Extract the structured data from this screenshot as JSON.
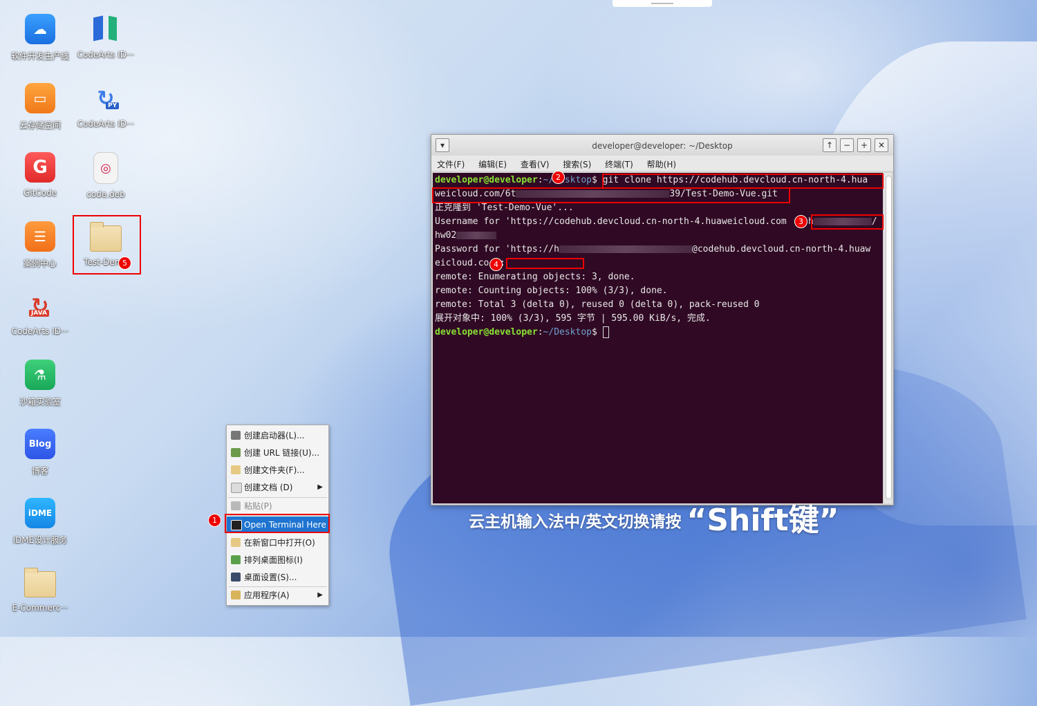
{
  "desktop": {
    "icons": [
      {
        "label": "软件开发生产线",
        "icon": "devcloud-icon"
      },
      {
        "label": "CodeArts ID···",
        "icon": "codearts-ide-icon"
      },
      {
        "label": "云存储空间",
        "icon": "cloud-storage-icon"
      },
      {
        "label": "CodeArts ID···",
        "icon": "codearts-python-icon",
        "badge": "PY"
      },
      {
        "label": "GitCode",
        "icon": "gitcode-icon",
        "glyph": "G"
      },
      {
        "label": "code.deb",
        "icon": "deb-package-icon"
      },
      {
        "label": "案例中心",
        "icon": "case-center-icon"
      },
      {
        "label": "Test-Demo",
        "icon": "folder-icon"
      },
      {
        "label": "CodeArts ID···",
        "icon": "codearts-java-icon",
        "badge": "JAVA"
      },
      {
        "label": "沙箱实验室",
        "icon": "sandbox-lab-icon"
      },
      {
        "label": "博客",
        "icon": "blog-icon",
        "glyph": "Blog"
      },
      {
        "label": "iDME设计服务",
        "icon": "idme-icon",
        "glyph": "iDME"
      },
      {
        "label": "E-Commerc···",
        "icon": "folder-icon"
      }
    ],
    "ime_hint": "云主机输入法中/英文切换请按",
    "ime_key": "“Shift键”"
  },
  "annotations": [
    "1",
    "2",
    "3",
    "4",
    "5"
  ],
  "terminal": {
    "title": "developer@developer: ~/Desktop",
    "menu": [
      "文件(F)",
      "编辑(E)",
      "查看(V)",
      "搜索(S)",
      "终端(T)",
      "帮助(H)"
    ],
    "prompt_user": "developer@developer",
    "prompt_path": "~/Desktop",
    "prompt_sep": ":",
    "prompt_end": "$",
    "command": "git clone https://codehub.devcloud.cn-north-4.hua",
    "url_cont_a": "weicloud.com/6t",
    "url_cont_b": "39/Test-Demo-Vue.git",
    "out_cloning": "正克隆到 'Test-Demo-Vue'...",
    "out_username": "Username for 'https://codehub.devcloud.cn-north-4.huaweicloud.com",
    "username_typed": "h",
    "username_end": "/",
    "username_echo": "hw02",
    "pw_prefix": "Password for 'https://h",
    "pw_host": "@codehub.devcloud.cn-north-4.huaw",
    "pw_cont": "eicloud.co",
    "pw_colon": ":",
    "remote1": "remote: Enumerating objects: 3, done.",
    "remote2": "remote: Counting objects: 100% (3/3), done.",
    "remote3": "remote: Total 3 (delta 0), reused 0 (delta 0), pack-reused 0",
    "unpack": "展开对象中: 100% (3/3), 595 字节 | 595.00 KiB/s, 完成."
  },
  "context_menu": {
    "items": [
      {
        "label": "创建启动器(L)...",
        "icon": "launcher-icon"
      },
      {
        "label": "创建 URL 链接(U)...",
        "icon": "link-icon"
      },
      {
        "label": "创建文件夹(F)...",
        "icon": "new-folder-icon"
      },
      {
        "label": "创建文档 (D)",
        "icon": "new-document-icon",
        "submenu": true
      },
      {
        "label": "粘贴(P)",
        "icon": "paste-icon",
        "disabled": true
      },
      {
        "label": "Open Terminal Here",
        "icon": "terminal-icon",
        "highlighted": true
      },
      {
        "label": "在新窗口中打开(O)",
        "icon": "open-window-icon"
      },
      {
        "label": "排列桌面图标(I)",
        "icon": "sort-icon"
      },
      {
        "label": "桌面设置(S)...",
        "icon": "desktop-settings-icon"
      },
      {
        "label": "应用程序(A)",
        "icon": "applications-icon",
        "submenu": true
      }
    ]
  },
  "colors": {
    "terminal_bg": "#300a24",
    "prompt_green": "#8ae234",
    "prompt_blue": "#729fcf",
    "highlight": "#1e74d0",
    "annotation_red": "#e00000"
  }
}
